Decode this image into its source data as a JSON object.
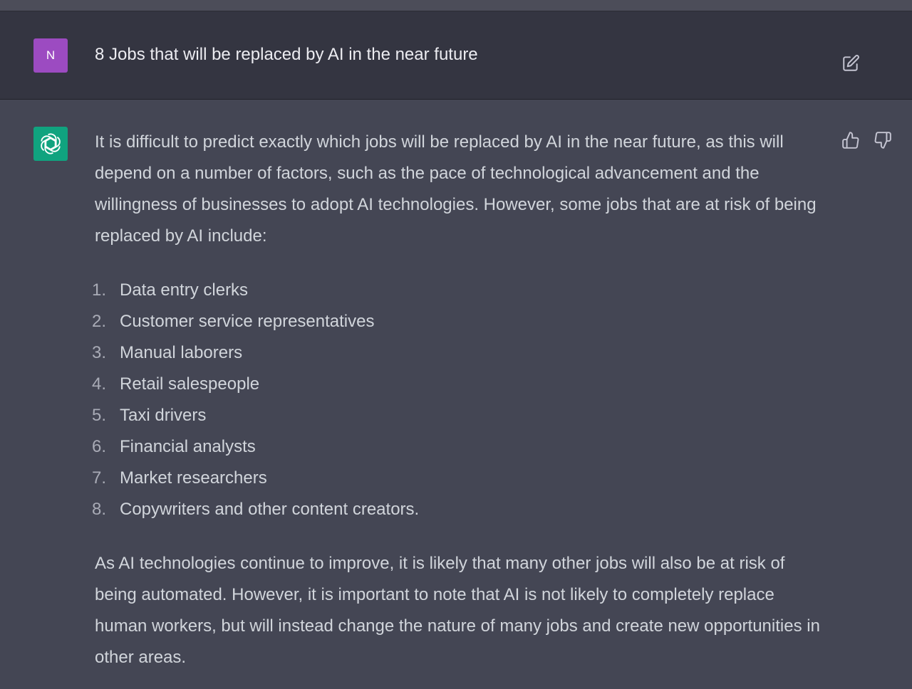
{
  "user_message": {
    "avatar_initial": "N",
    "text": "8 Jobs that will be replaced by AI in the near future"
  },
  "assistant_message": {
    "intro": "It is difficult to predict exactly which jobs will be replaced by AI in the near future, as this will depend on a number of factors, such as the pace of technological advancement and the willingness of businesses to adopt AI technologies. However, some jobs that are at risk of being replaced by AI include:",
    "list": [
      {
        "number": "1.",
        "text": "Data entry clerks"
      },
      {
        "number": "2.",
        "text": "Customer service representatives"
      },
      {
        "number": "3.",
        "text": "Manual laborers"
      },
      {
        "number": "4.",
        "text": "Retail salespeople"
      },
      {
        "number": "5.",
        "text": "Taxi drivers"
      },
      {
        "number": "6.",
        "text": "Financial analysts"
      },
      {
        "number": "7.",
        "text": "Market researchers"
      },
      {
        "number": "8.",
        "text": "Copywriters and other content creators."
      }
    ],
    "conclusion": "As AI technologies continue to improve, it is likely that many other jobs will also be at risk of being automated. However, it is important to note that AI is not likely to completely replace human workers, but will instead change the nature of many jobs and create new opportunities in other areas."
  },
  "icons": {
    "edit": "edit-icon",
    "assistant_logo": "openai-logo-icon",
    "thumbs_up": "thumbs-up-icon",
    "thumbs_down": "thumbs-down-icon"
  },
  "colors": {
    "user_bg": "#343541",
    "assistant_bg": "#444654",
    "user_avatar": "#9c4bc1",
    "assistant_avatar": "#10a37f"
  }
}
